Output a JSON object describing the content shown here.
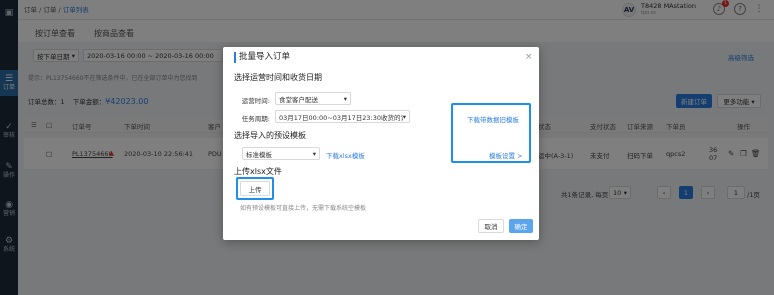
{
  "breadcrumb": {
    "part1": "订单",
    "sep1": "/",
    "part2": "订单",
    "sep2": "/",
    "current": "订单列表"
  },
  "user": {
    "avatar_text": "AV",
    "name": "T8428 MAstation",
    "sub": "tpo.ss",
    "notif_count": "1"
  },
  "sidebar": {
    "items": [
      {
        "icon": "▣",
        "label": ""
      },
      {
        "icon": "☰",
        "label": "订单"
      },
      {
        "icon": "✓",
        "label": "审核"
      },
      {
        "icon": "✎",
        "label": "操作"
      },
      {
        "icon": "◉",
        "label": "营销"
      },
      {
        "icon": "⚙",
        "label": "系统"
      }
    ]
  },
  "tabs": [
    {
      "label": "按订单查看"
    },
    {
      "label": "按商品查看"
    }
  ],
  "filters": {
    "date_type": "按下单日期",
    "date_range": "2020-03-16 00:00 ~ 2020-03-16 00:00",
    "advanced": "高级筛选"
  },
  "notice": "提示：PL13754660不在筛选条件中，已在全部订单中为您找到",
  "summary": {
    "total_label": "订单总数：",
    "total_value": "1",
    "amount_label": "下单金额：",
    "amount_value": "¥42023.00"
  },
  "actions": {
    "new_order": "新建订单",
    "more": "更多功能 ▾"
  },
  "table": {
    "headers": {
      "order_no": "订单号",
      "order_time": "下单时间",
      "customer": "客户",
      "status": "状态",
      "pay_status": "支付状态",
      "source": "订单来源",
      "creator": "下单员",
      "op": "操作"
    },
    "row": {
      "order_no": "PL13754660",
      "order_time": "2020-03-10 22:56:41",
      "customer": "PDU",
      "status": "运中(A-3-1)",
      "pay_status": "未支付",
      "source": "扫码下单",
      "creator": "qpcs2",
      "col13": "36 07"
    }
  },
  "pager": {
    "total": "共1条记录, 每页",
    "page_size": "10",
    "page_size_caret": "▾",
    "prev": "‹",
    "page": "1",
    "next": "›",
    "goto": "1",
    "goto_suffix": "/1页"
  },
  "dialog": {
    "title": "批量导入订单",
    "close": "×",
    "section1": "选择运营时间和收货日期",
    "op_time_label": "运营时间:",
    "op_time_value": "食堂客户配送",
    "cycle_label": "任务周期:",
    "cycle_value": "03月17日00:00~03月17日23:30收货的订单",
    "download_link": "下载带数据旧模板",
    "section2": "选择导入的预设模板",
    "template_value": "标准模板",
    "template_download": "下载xlsx模板",
    "template_settings": "模板设置 >",
    "section3": "上传xlsx文件",
    "upload_button": "上传",
    "hint": "如有预设模板可直接上传，无需下载系统空模板",
    "cancel": "取消",
    "confirm": "确定"
  },
  "colors": {
    "accent": "#2a7de1",
    "highlight": "#1e90e6",
    "sidebar": "#1c2a3a"
  }
}
